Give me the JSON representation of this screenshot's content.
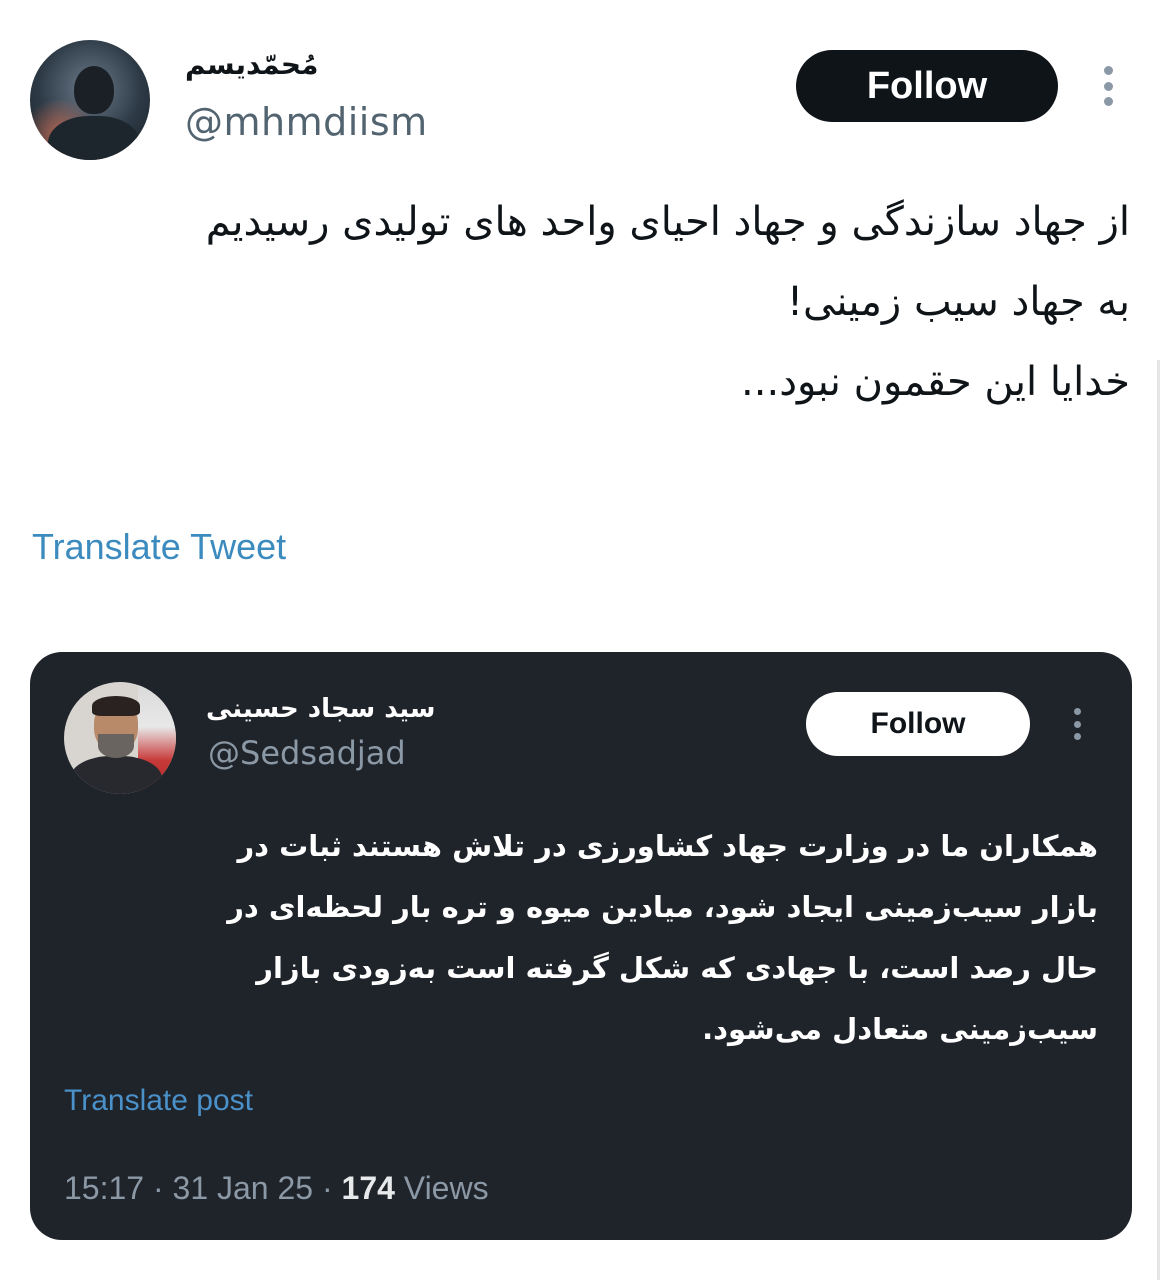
{
  "author": {
    "display_name": "مُحمّدیسم",
    "handle": "@mhmdiism",
    "follow_label": "Follow"
  },
  "tweet": {
    "lines": [
      "از جهاد سازندگی و جهاد احیای واحد های تولیدی رسیدیم",
      "به جهاد سیب زمینی!",
      "خدایا این حقمون نبود..."
    ],
    "translate_label": "Translate Tweet"
  },
  "quoted": {
    "display_name": "سید سجاد حسینی",
    "handle": "@Sedsadjad",
    "follow_label": "Follow",
    "lines": [
      "همکاران ما در وزارت جهاد کشاورزی در تلاش هستند ثبات در",
      "بازار سیب‌زمینی ایجاد شود، میادین میوه و تره بار لحظه‌ای در",
      "حال رصد است، با جهادی که شکل گرفته است به‌زودی بازار",
      "سیب‌زمینی متعادل می‌شود."
    ],
    "translate_label": "Translate post",
    "time": "15:17",
    "date": "31 Jan 25",
    "separator": "·",
    "views_count": "174",
    "views_label": "Views"
  },
  "colors": {
    "follow_dark": "#0f1419",
    "quote_bg": "#1f232a",
    "link_blue": "#3b8bbf",
    "muted_gray": "#8b98a5"
  },
  "icons": {
    "more_menu": "more-vertical-icon"
  }
}
